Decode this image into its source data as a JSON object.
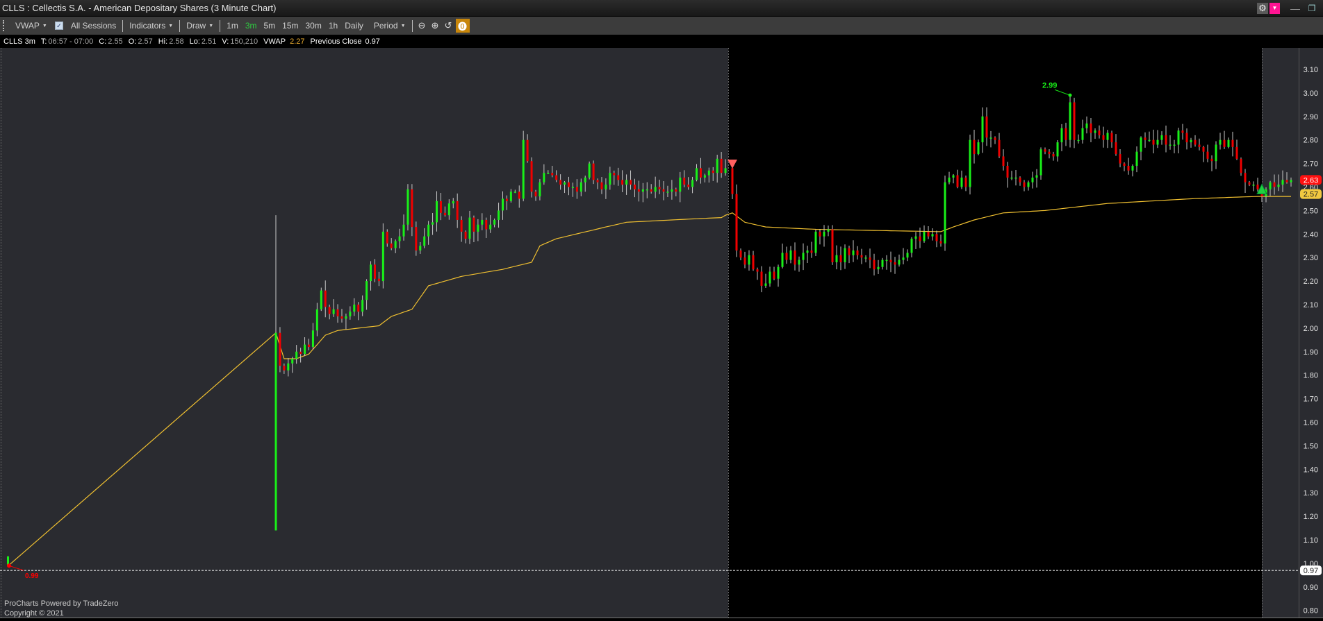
{
  "window": {
    "title": "CLLS : Cellectis S.A. - American Depositary Shares (3 Minute Chart)",
    "gear_icon": "gear-icon",
    "dropdown_icon": "caret-down-icon",
    "minimize": "—",
    "restore": "❐"
  },
  "toolbar": {
    "vwap": "VWAP",
    "all_sessions": "All Sessions",
    "all_sessions_checked": true,
    "indicators": "Indicators",
    "draw": "Draw",
    "intervals": [
      "1m",
      "3m",
      "5m",
      "15m",
      "30m",
      "1h",
      "Daily"
    ],
    "active_interval": "3m",
    "period": "Period"
  },
  "info": {
    "symbol": "CLLS 3m",
    "t_label": "T:",
    "t_value": "06:57 - 07:00",
    "c_label": "C:",
    "c_value": "2.55",
    "o_label": "O:",
    "o_value": "2.57",
    "hi_label": "Hi:",
    "hi_value": "2.58",
    "lo_label": "Lo:",
    "lo_value": "2.51",
    "v_label": "V:",
    "v_value": "150,210",
    "vwap_label": "VWAP",
    "vwap_value": "2.27",
    "prev_label": "Previous Close",
    "prev_value": "0.97"
  },
  "colors": {
    "up": "#19f019",
    "down": "#f00000",
    "wick": "#c8c8c8",
    "vwap": "#f0c030",
    "ext_bg": "#2a2b30",
    "reg_bg": "#000000"
  },
  "chart_data": {
    "type": "candlestick",
    "y_ticks": [
      "0.80",
      "0.90",
      "1.00",
      "1.10",
      "1.20",
      "1.30",
      "1.40",
      "1.50",
      "1.60",
      "1.70",
      "1.80",
      "1.90",
      "2.00",
      "2.10",
      "2.20",
      "2.30",
      "2.40",
      "2.50",
      "2.60",
      "2.70",
      "2.80",
      "2.90",
      "3.00",
      "3.10"
    ],
    "ylim": [
      0.78,
      3.13
    ],
    "prior_candle": {
      "o": 0.99,
      "h": 1.03,
      "l": 0.99,
      "c": 1.01
    },
    "prior_low_label": "0.99",
    "first_candle": {
      "o": 1.14,
      "h": 2.48,
      "l": 1.14,
      "c": 1.98
    },
    "premarket_closes": [
      1.98,
      1.84,
      1.82,
      1.85,
      1.87,
      1.9,
      1.89,
      1.93,
      1.92,
      1.99,
      2.08,
      2.16,
      2.09,
      2.06,
      2.08,
      2.05,
      2.04,
      2.05,
      2.07,
      2.1,
      2.07,
      2.12,
      2.2,
      2.27,
      2.21,
      2.2,
      2.41,
      2.36,
      2.34,
      2.37,
      2.39,
      2.44,
      2.59,
      2.43,
      2.33,
      2.35,
      2.39,
      2.44,
      2.45,
      2.54,
      2.49,
      2.48,
      2.53,
      2.54,
      2.46,
      2.41,
      2.38,
      2.47,
      2.41,
      2.44,
      2.46,
      2.42,
      2.44,
      2.46,
      2.5,
      2.55,
      2.54,
      2.58,
      2.58,
      2.55,
      2.8,
      2.71,
      2.58,
      2.56,
      2.62,
      2.66,
      2.66,
      2.65,
      2.63,
      2.61,
      2.62,
      2.6,
      2.6,
      2.58,
      2.62,
      2.64,
      2.7,
      2.63,
      2.62,
      2.59,
      2.61,
      2.66,
      2.65,
      2.63,
      2.61,
      2.63,
      2.61,
      2.59,
      2.58,
      2.59,
      2.59,
      2.58,
      2.6,
      2.59,
      2.58,
      2.58,
      2.59,
      2.58,
      2.64,
      2.61,
      2.6,
      2.63,
      2.68,
      2.64,
      2.65,
      2.67,
      2.66,
      2.72,
      2.66,
      2.68
    ],
    "regular_closes": [
      2.57,
      2.33,
      2.3,
      2.27,
      2.31,
      2.25,
      2.24,
      2.18,
      2.19,
      2.24,
      2.21,
      2.26,
      2.32,
      2.29,
      2.33,
      2.27,
      2.29,
      2.32,
      2.33,
      2.32,
      2.41,
      2.39,
      2.41,
      2.42,
      2.28,
      2.31,
      2.28,
      2.34,
      2.31,
      2.33,
      2.31,
      2.3,
      2.3,
      2.29,
      2.25,
      2.26,
      2.29,
      2.29,
      2.28,
      2.27,
      2.29,
      2.3,
      2.32,
      2.38,
      2.39,
      2.37,
      2.41,
      2.39,
      2.4,
      2.37,
      2.36,
      2.62,
      2.64,
      2.65,
      2.6,
      2.64,
      2.6,
      2.8,
      2.74,
      2.79,
      2.9,
      2.81,
      2.81,
      2.8,
      2.73,
      2.69,
      2.64,
      2.64,
      2.64,
      2.62,
      2.6,
      2.62,
      2.64,
      2.65,
      2.76,
      2.75,
      2.74,
      2.73,
      2.79,
      2.85,
      2.8,
      2.96,
      2.8,
      2.8,
      2.85,
      2.87,
      2.83,
      2.84,
      2.82,
      2.8,
      2.83,
      2.79,
      2.74,
      2.7,
      2.69,
      2.67,
      2.69,
      2.75,
      2.81,
      2.8,
      2.8,
      2.78,
      2.8,
      2.82,
      2.78,
      2.78,
      2.78,
      2.84,
      2.83,
      2.79,
      2.8,
      2.78,
      2.77,
      2.75,
      2.72,
      2.71,
      2.78,
      2.8,
      2.77,
      2.8,
      2.77,
      2.72,
      2.66,
      2.62,
      2.61,
      2.61,
      2.59,
      2.56
    ],
    "postmarket_closes": [
      2.59,
      2.62,
      2.6,
      2.61,
      2.63,
      2.62,
      2.63
    ],
    "high_annotation": {
      "label": "2.99",
      "value": 2.99
    },
    "vwap_anchors": [
      [
        0,
        1.98
      ],
      [
        2,
        1.87
      ],
      [
        5,
        1.87
      ],
      [
        8,
        1.89
      ],
      [
        12,
        1.97
      ],
      [
        15,
        1.99
      ],
      [
        25,
        2.01
      ],
      [
        28,
        2.05
      ],
      [
        33,
        2.08
      ],
      [
        35,
        2.13
      ],
      [
        37,
        2.18
      ],
      [
        45,
        2.22
      ],
      [
        55,
        2.25
      ],
      [
        62,
        2.28
      ],
      [
        64,
        2.35
      ],
      [
        68,
        2.38
      ],
      [
        80,
        2.43
      ],
      [
        85,
        2.45
      ],
      [
        96,
        2.46
      ],
      [
        108,
        2.47
      ],
      [
        110,
        2.49
      ],
      [
        113,
        2.45
      ],
      [
        118,
        2.43
      ],
      [
        130,
        2.42
      ],
      [
        160,
        2.41
      ],
      [
        163,
        2.43
      ],
      [
        168,
        2.46
      ],
      [
        175,
        2.49
      ],
      [
        185,
        2.5
      ],
      [
        200,
        2.53
      ],
      [
        220,
        2.55
      ],
      [
        236,
        2.56
      ],
      [
        245,
        2.56
      ]
    ],
    "prev_close": {
      "value": 0.97,
      "label": "0.97"
    },
    "last_price": {
      "value": 2.63,
      "label": "2.63"
    },
    "vwap_price": {
      "value": 2.57,
      "label": "2.57"
    }
  },
  "footer": {
    "line1": "ProCharts Powered by TradeZero",
    "line2": "Copyright © 2021"
  }
}
